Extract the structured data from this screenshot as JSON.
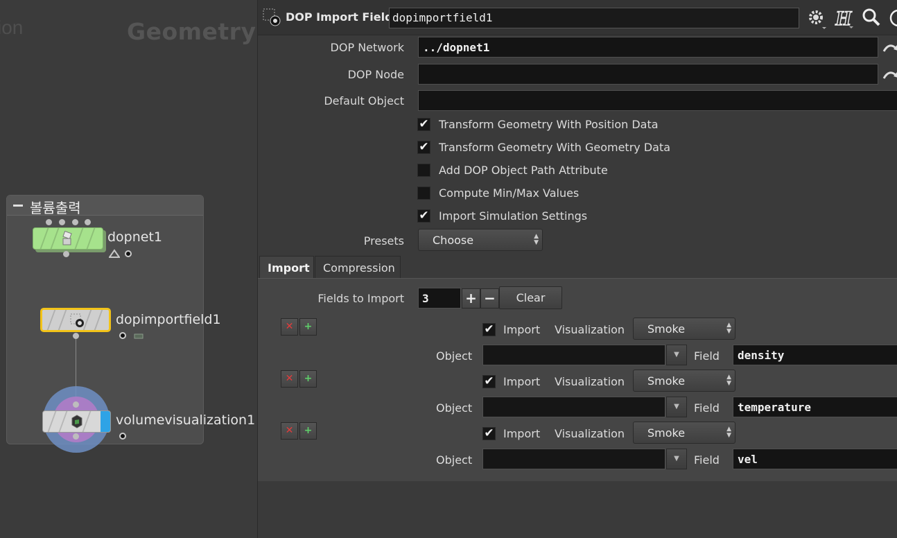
{
  "network": {
    "context_left": "ion",
    "context_title": "Geometry",
    "netbox_title": "볼륨출력",
    "nodes": [
      {
        "name": "dopnet1"
      },
      {
        "name": "dopimportfield1"
      },
      {
        "name": "volumevisualization1"
      }
    ]
  },
  "params": {
    "op_type": "DOP Import Fields",
    "node_name": "dopimportfield1",
    "dop_network": {
      "label": "DOP Network",
      "value": "../dopnet1"
    },
    "dop_node": {
      "label": "DOP Node",
      "value": ""
    },
    "default_object": {
      "label": "Default Object",
      "value": ""
    },
    "checks": [
      {
        "label": "Transform Geometry With Position Data",
        "checked": true,
        "mark": "✔"
      },
      {
        "label": "Transform Geometry With Geometry Data",
        "checked": true,
        "mark": "✔"
      },
      {
        "label": "Add DOP Object Path Attribute",
        "checked": false,
        "mark": ""
      },
      {
        "label": "Compute Min/Max Values",
        "checked": false,
        "mark": ""
      },
      {
        "label": "Import Simulation Settings",
        "checked": true,
        "mark": "✔"
      }
    ],
    "presets": {
      "label": "Presets",
      "value": "Choose"
    },
    "tabs": [
      "Import",
      "Compression"
    ],
    "fields_to_import": {
      "label": "Fields to Import",
      "value": "3",
      "plus": "+",
      "minus": "−",
      "clear": "Clear"
    },
    "fields": [
      {
        "import_label": "Import",
        "import_mark": "✔",
        "vis_label": "Visualization",
        "vis_value": "Smoke",
        "object_label": "Object",
        "object_value": "",
        "field_label": "Field",
        "field_value": "density"
      },
      {
        "import_label": "Import",
        "import_mark": "✔",
        "vis_label": "Visualization",
        "vis_value": "Smoke",
        "object_label": "Object",
        "object_value": "",
        "field_label": "Field",
        "field_value": "temperature"
      },
      {
        "import_label": "Import",
        "import_mark": "✔",
        "vis_label": "Visualization",
        "vis_value": "Smoke",
        "object_label": "Object",
        "object_value": "",
        "field_label": "Field",
        "field_value": "vel"
      }
    ],
    "remove_glyph": "✕",
    "insert_glyph": "+"
  },
  "colors": {
    "dopnet_node": "#a6e28c",
    "selected_outline": "#f2c318",
    "vis_ring": "#6f8fc4",
    "vis_inner": "#b07cc6",
    "display_flag": "#2ea3e6",
    "remove_x": "#e23c3c",
    "insert_plus": "#5fd06a"
  },
  "icons": [
    "gear-icon",
    "help-h-icon",
    "search-icon",
    "info-icon",
    "channel-reference-icon",
    "dop-import-fields-icon"
  ]
}
